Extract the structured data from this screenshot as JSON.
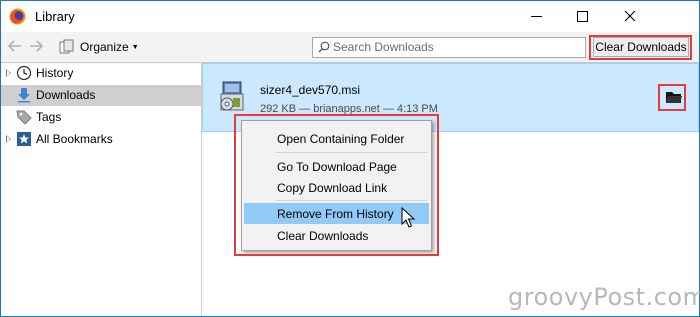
{
  "window": {
    "title": "Library"
  },
  "toolbar": {
    "organize_label": "Organize",
    "search_placeholder": "Search Downloads",
    "clear_downloads_label": "Clear Downloads"
  },
  "sidebar": {
    "items": [
      {
        "label": "History",
        "icon": "clock-icon",
        "expandable": true,
        "selected": false
      },
      {
        "label": "Downloads",
        "icon": "download-arrow-icon",
        "expandable": false,
        "selected": true
      },
      {
        "label": "Tags",
        "icon": "tag-icon",
        "expandable": false,
        "selected": false
      },
      {
        "label": "All Bookmarks",
        "icon": "star-icon",
        "expandable": true,
        "selected": false
      }
    ]
  },
  "download": {
    "filename": "sizer4_dev570.msi",
    "meta": "292 KB — brianapps.net — 4:13 PM",
    "file_icon": "msi-installer-icon",
    "folder_icon": "folder-icon"
  },
  "context_menu": {
    "items": [
      {
        "label": "Open Containing Folder"
      },
      {
        "label": "Go To Download Page"
      },
      {
        "label": "Copy Download Link"
      },
      {
        "label": "Remove From History",
        "highlighted": true
      },
      {
        "label": "Clear Downloads"
      }
    ]
  },
  "watermark": "groovyPost.com",
  "colors": {
    "highlight_box": "#e23c3c",
    "selected_row": "#cce8ff",
    "menu_hover": "#91c9f7"
  }
}
